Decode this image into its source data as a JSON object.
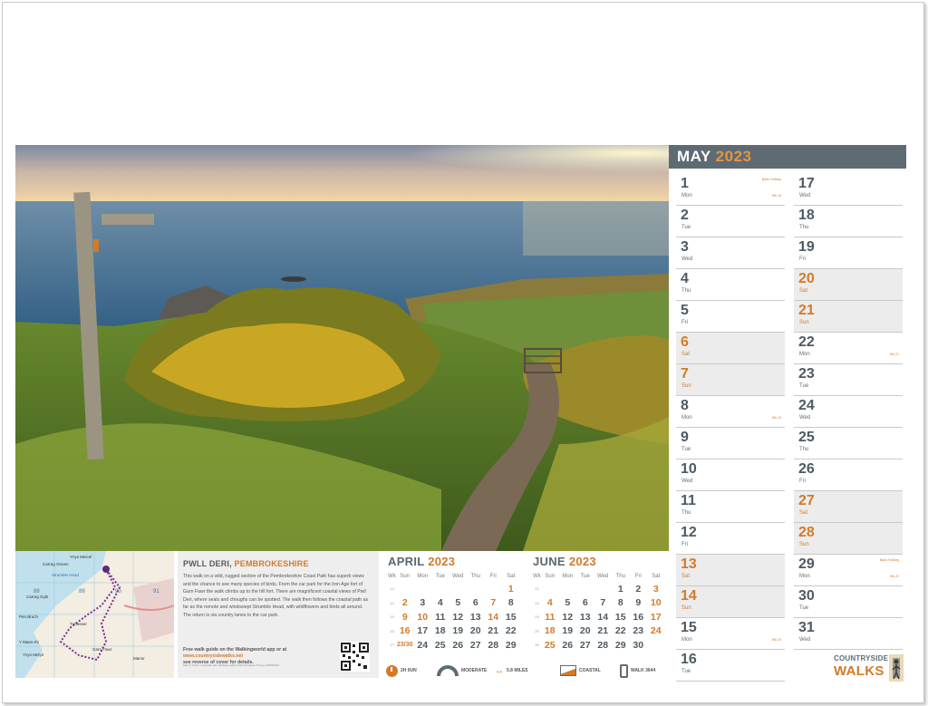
{
  "month": {
    "name": "MAY",
    "year": "2023"
  },
  "days_left": [
    {
      "num": "1",
      "dn": "Mon",
      "note": "Bank Holiday",
      "wk": "Wk 18",
      "weekend": false,
      "grey": false
    },
    {
      "num": "2",
      "dn": "Tue",
      "note": "",
      "wk": "",
      "weekend": false,
      "grey": false
    },
    {
      "num": "3",
      "dn": "Wed",
      "note": "",
      "wk": "",
      "weekend": false,
      "grey": false
    },
    {
      "num": "4",
      "dn": "Thu",
      "note": "",
      "wk": "",
      "weekend": false,
      "grey": false
    },
    {
      "num": "5",
      "dn": "Fri",
      "note": "",
      "wk": "",
      "weekend": false,
      "grey": false
    },
    {
      "num": "6",
      "dn": "Sat",
      "note": "",
      "wk": "",
      "weekend": true,
      "grey": true
    },
    {
      "num": "7",
      "dn": "Sun",
      "note": "",
      "wk": "",
      "weekend": true,
      "grey": true
    },
    {
      "num": "8",
      "dn": "Mon",
      "note": "",
      "wk": "Wk 19",
      "weekend": false,
      "grey": false
    },
    {
      "num": "9",
      "dn": "Tue",
      "note": "",
      "wk": "",
      "weekend": false,
      "grey": false
    },
    {
      "num": "10",
      "dn": "Wed",
      "note": "",
      "wk": "",
      "weekend": false,
      "grey": false
    },
    {
      "num": "11",
      "dn": "Thu",
      "note": "",
      "wk": "",
      "weekend": false,
      "grey": false
    },
    {
      "num": "12",
      "dn": "Fri",
      "note": "",
      "wk": "",
      "weekend": false,
      "grey": false
    },
    {
      "num": "13",
      "dn": "Sat",
      "note": "",
      "wk": "",
      "weekend": true,
      "grey": true
    },
    {
      "num": "14",
      "dn": "Sun",
      "note": "",
      "wk": "",
      "weekend": true,
      "grey": true
    },
    {
      "num": "15",
      "dn": "Mon",
      "note": "",
      "wk": "Wk 20",
      "weekend": false,
      "grey": false
    },
    {
      "num": "16",
      "dn": "Tue",
      "note": "",
      "wk": "",
      "weekend": false,
      "grey": false
    }
  ],
  "days_right": [
    {
      "num": "17",
      "dn": "Wed",
      "note": "",
      "wk": "",
      "weekend": false,
      "grey": false
    },
    {
      "num": "18",
      "dn": "Thu",
      "note": "",
      "wk": "",
      "weekend": false,
      "grey": false
    },
    {
      "num": "19",
      "dn": "Fri",
      "note": "",
      "wk": "",
      "weekend": false,
      "grey": false
    },
    {
      "num": "20",
      "dn": "Sat",
      "note": "",
      "wk": "",
      "weekend": true,
      "grey": true
    },
    {
      "num": "21",
      "dn": "Sun",
      "note": "",
      "wk": "",
      "weekend": true,
      "grey": true
    },
    {
      "num": "22",
      "dn": "Mon",
      "note": "",
      "wk": "Wk 21",
      "weekend": false,
      "grey": false
    },
    {
      "num": "23",
      "dn": "Tue",
      "note": "",
      "wk": "",
      "weekend": false,
      "grey": false
    },
    {
      "num": "24",
      "dn": "Wed",
      "note": "",
      "wk": "",
      "weekend": false,
      "grey": false
    },
    {
      "num": "25",
      "dn": "Thu",
      "note": "",
      "wk": "",
      "weekend": false,
      "grey": false
    },
    {
      "num": "26",
      "dn": "Fri",
      "note": "",
      "wk": "",
      "weekend": false,
      "grey": false
    },
    {
      "num": "27",
      "dn": "Sat",
      "note": "",
      "wk": "",
      "weekend": true,
      "grey": true
    },
    {
      "num": "28",
      "dn": "Sun",
      "note": "",
      "wk": "",
      "weekend": true,
      "grey": true
    },
    {
      "num": "29",
      "dn": "Mon",
      "note": "Bank Holiday",
      "wk": "Wk 22",
      "weekend": false,
      "grey": false
    },
    {
      "num": "30",
      "dn": "Tue",
      "note": "",
      "wk": "",
      "weekend": false,
      "grey": false
    },
    {
      "num": "31",
      "dn": "Wed",
      "note": "",
      "wk": "",
      "weekend": false,
      "grey": false
    }
  ],
  "walk": {
    "title": "PWLL DERI,",
    "location": "PEMBROKESHIRE",
    "description": "This walk on a wild, rugged section of the Pembrokeshire Coast Path has superb views and the chance to see many species of birds. From the car park for the Iron Age fort of Garn Fawr the walk climbs up to the hill fort. There are magnificent coastal views of Pwll Deri, where seals and choughs can be spotted. The walk then follows the coastal path as far as the remote and windswept Strumble Head, with wildflowers and birds all around. The return is via country lanes to the car park.",
    "guide_pre": "Free walk guide on the Walkingworld app or at",
    "guide_url": "www.countrysidewalks.net",
    "guide_post": "see reverse of cover for details.",
    "copyright": "Map © Crown copyright and database rights 2022 Ordnance Survey 100034421"
  },
  "legend": [
    {
      "icon": "clock-icon",
      "label": "2H 0UN"
    },
    {
      "icon": "gradient-icon",
      "label": "MODERATE"
    },
    {
      "icon": "distance-icon",
      "label": "5.8 MILES"
    },
    {
      "icon": "coastal-icon",
      "label": "COASTAL"
    },
    {
      "icon": "phone-icon",
      "label": "WALK 3644"
    }
  ],
  "april": {
    "name": "APRIL",
    "year": "2023",
    "headers": [
      "Wk",
      "Sun",
      "Mon",
      "Tue",
      "Wed",
      "Thu",
      "Fri",
      "Sat"
    ],
    "rows": [
      [
        "13",
        "",
        "",
        "",
        "",
        "",
        "",
        "1"
      ],
      [
        "14",
        "2",
        "3",
        "4",
        "5",
        "6",
        "7",
        "8"
      ],
      [
        "15",
        "9",
        "10",
        "11",
        "12",
        "13",
        "14",
        "15"
      ],
      [
        "16",
        "16",
        "17",
        "18",
        "19",
        "20",
        "21",
        "22"
      ],
      [
        "17",
        "23/30",
        "24",
        "25",
        "26",
        "27",
        "28",
        "29"
      ]
    ],
    "weekend": [
      [
        7
      ],
      [
        1,
        6
      ],
      [
        1,
        2,
        6
      ],
      [
        1
      ],
      [
        1
      ]
    ]
  },
  "june": {
    "name": "JUNE",
    "year": "2023",
    "headers": [
      "Wk",
      "Sun",
      "Mon",
      "Tue",
      "Wed",
      "Thu",
      "Fri",
      "Sat"
    ],
    "rows": [
      [
        "22",
        "",
        "",
        "",
        "",
        "1",
        "2",
        "3"
      ],
      [
        "23",
        "4",
        "5",
        "6",
        "7",
        "8",
        "9",
        "10"
      ],
      [
        "24",
        "11",
        "12",
        "13",
        "14",
        "15",
        "16",
        "17"
      ],
      [
        "25",
        "18",
        "19",
        "20",
        "21",
        "22",
        "23",
        "24"
      ],
      [
        "26",
        "25",
        "26",
        "27",
        "28",
        "29",
        "30",
        ""
      ]
    ],
    "weekend": [
      [
        7
      ],
      [
        1,
        7
      ],
      [
        1,
        7
      ],
      [
        1,
        7
      ],
      [
        1
      ]
    ]
  },
  "brand": {
    "line1": "COUNTRYSIDE",
    "line2": "WALKS"
  },
  "map_labels": [
    "Ynys Meicel",
    "Carreg Onnen",
    "Strumble Head",
    "Carreg Gybi",
    "88",
    "89",
    "90",
    "91",
    "Pen Bruch",
    "Trefasser",
    "Y Maen-rhi",
    "Ynys Melyn",
    "Garn Fawr",
    "Manor"
  ],
  "colors": {
    "accent": "#d27a2a",
    "header": "#5e6b73",
    "dayText": "#4e5a63"
  }
}
